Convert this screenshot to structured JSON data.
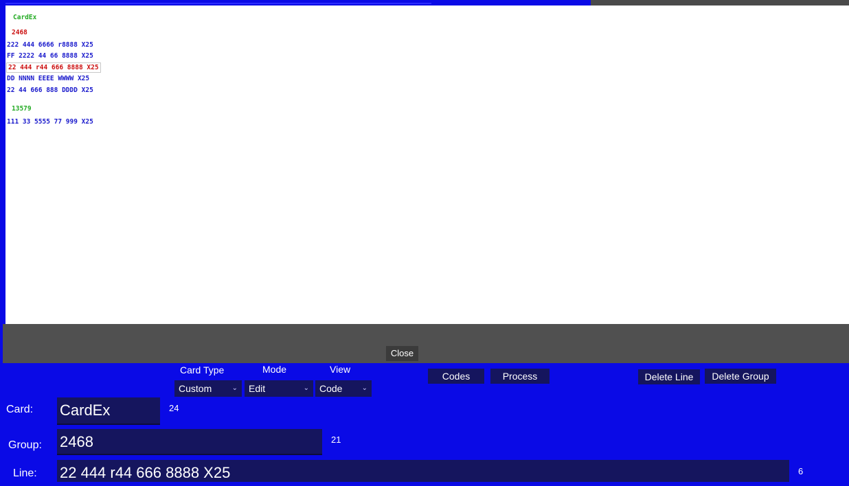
{
  "card_view": {
    "card_name": "CardEx",
    "groups": [
      {
        "id": "2468",
        "lines": [
          "222 444 6666 r8888 X25",
          "FF 2222 44 66 8888 X25",
          "22 444 r44 666 8888 X25",
          "DD NNNN EEEE WWWW X25",
          "22 44 666 888 DDDD X25"
        ]
      },
      {
        "id": "13579",
        "lines": [
          "111 33 5555 77 999 X25"
        ]
      }
    ]
  },
  "close_label": "Close",
  "controls": {
    "card_type": {
      "label": "Card Type",
      "value": "Custom"
    },
    "mode": {
      "label": "Mode",
      "value": "Edit"
    },
    "view": {
      "label": "View",
      "value": "Code"
    },
    "codes_label": "Codes",
    "process_label": "Process",
    "delete_line_label": "Delete Line",
    "delete_group_label": "Delete Group"
  },
  "fields": {
    "card": {
      "label": "Card:",
      "value": "CardEx",
      "count": "24"
    },
    "group": {
      "label": "Group:",
      "value": "2468",
      "count": "21"
    },
    "line": {
      "label": "Line:",
      "value": "22 444 r44 666 8888 X25",
      "count": "6"
    }
  },
  "colors": {
    "panel": "#0a0ae6",
    "field": "#15155e",
    "group_selected": "#cc1111",
    "group_normal": "#22aa22",
    "line_text": "#1a1acc"
  }
}
